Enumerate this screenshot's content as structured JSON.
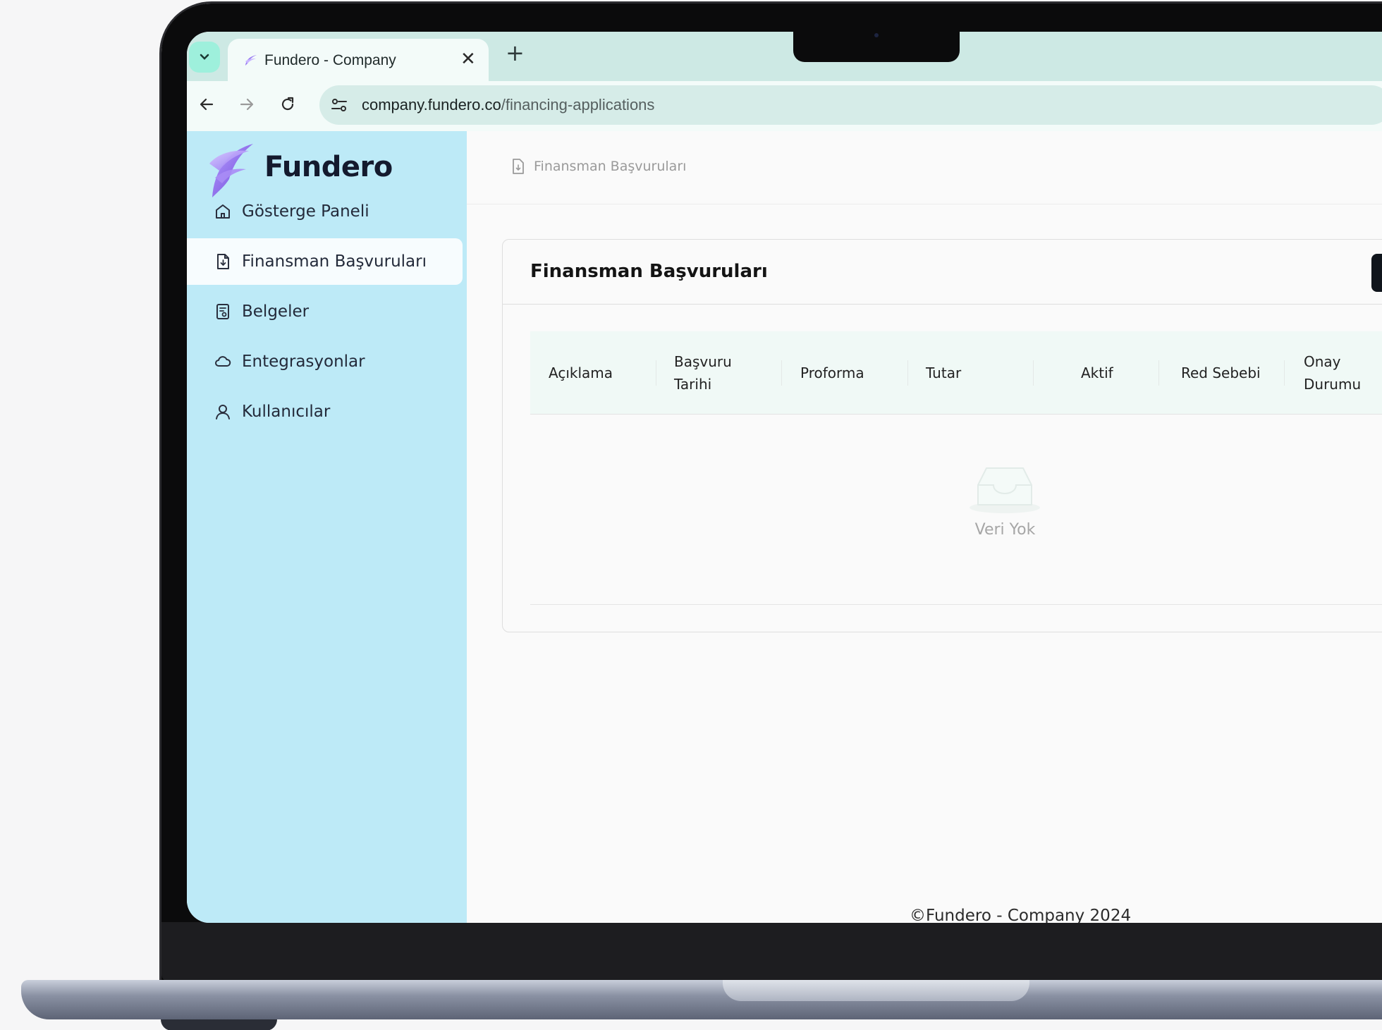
{
  "browser": {
    "tab_title": "Fundero - Company",
    "tab_close": "✕",
    "new_tab": "+",
    "url_domain": "company.fundero.co",
    "url_path": "/financing-applications"
  },
  "sidebar": {
    "brand": "Fundero",
    "items": [
      {
        "label": "Gösterge Paneli",
        "icon": "home-icon"
      },
      {
        "label": "Finansman Başvuruları",
        "icon": "file-icon",
        "active": true
      },
      {
        "label": "Belgeler",
        "icon": "document-icon"
      },
      {
        "label": "Entegrasyonlar",
        "icon": "cloud-icon"
      },
      {
        "label": "Kullanıcılar",
        "icon": "user-icon"
      }
    ]
  },
  "breadcrumb": {
    "label": "Finansman Başvuruları"
  },
  "card": {
    "title": "Finansman Başvuruları",
    "columns": [
      "Açıklama",
      "Başvuru Tarihi",
      "Proforma",
      "Tutar",
      "Aktif",
      "Red Sebebi",
      "Onay Durumu"
    ],
    "empty_text": "Veri Yok"
  },
  "footer": {
    "text": "©Fundero - Company 2024"
  },
  "colors": {
    "sidebar_bg": "#bdeaf7",
    "tab_bar": "#cde9e4",
    "table_header": "#f0f9f6",
    "brand_purple": "#8b6cf0"
  }
}
